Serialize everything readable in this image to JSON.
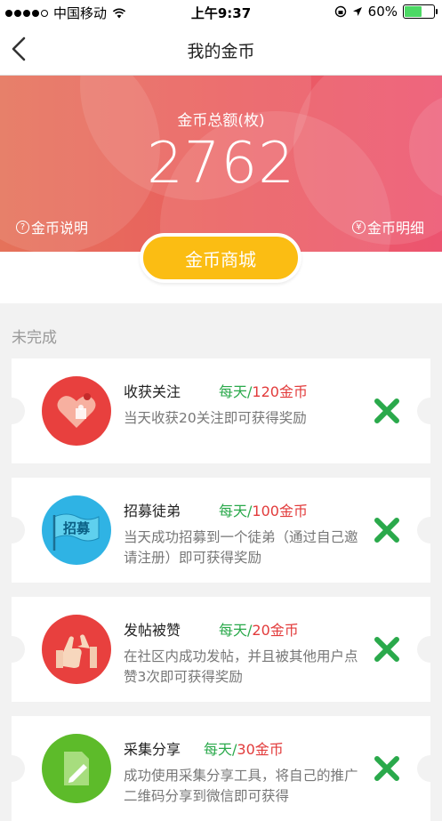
{
  "status_bar": {
    "carrier": "中国移动",
    "time": "上午9:37",
    "battery": "60%",
    "battery_level": 0.6
  },
  "nav": {
    "title": "我的金币"
  },
  "hero": {
    "total_label": "金币总额(枚)",
    "total_value": "2762",
    "explain_link": "金币说明",
    "detail_link": "金币明细",
    "mall_button": "金币商城"
  },
  "section_title": "未完成",
  "colors": {
    "hero_start": "#e5725a",
    "hero_end": "#ec5470",
    "mall_button": "#fbbd13",
    "reward_green": "#2aa94b",
    "reward_red": "#e23b3b",
    "x_green": "#2aa94b"
  },
  "tasks": [
    {
      "name": "收获关注",
      "per": "每天",
      "amount": "120金币",
      "desc": "当天收获20关注即可获得奖励",
      "icon": "heart-puzzle-icon",
      "icon_color": "#e8403e"
    },
    {
      "name": "招募徒弟",
      "per": "每天",
      "amount": "100金币",
      "desc": "当天成功招募到一个徒弟（通过自己邀请注册）即可获得奖励",
      "icon": "recruit-flag-icon",
      "icon_text": "招募",
      "icon_color": "#2fb3e4"
    },
    {
      "name": "发帖被赞",
      "per": "每天",
      "amount": "20金币",
      "desc": "在社区内成功发帖，并且被其他用户点赞3次即可获得奖励",
      "icon": "thumbs-up-icon",
      "icon_color": "#e8403e"
    },
    {
      "name": "采集分享",
      "per": "每天",
      "amount": "30金币",
      "desc": "成功使用采集分享工具，将自己的推广二维码分享到微信即可获得",
      "icon": "note-pencil-icon",
      "icon_color": "#5dbb2a"
    }
  ]
}
